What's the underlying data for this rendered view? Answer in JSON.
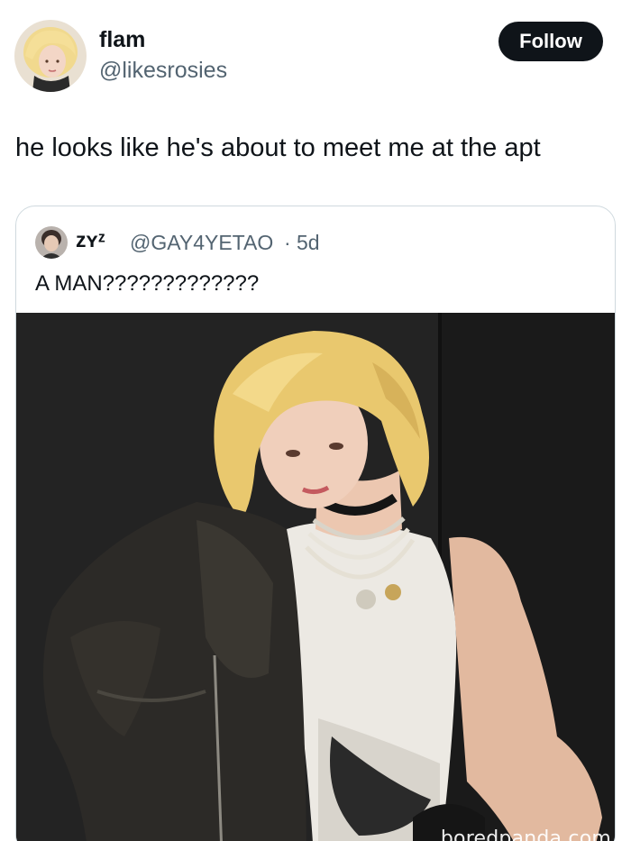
{
  "tweet": {
    "author": {
      "name": "flam",
      "handle": "@likesrosies"
    },
    "follow_label": "Follow",
    "text": "he looks like he's about to meet me at the apt"
  },
  "quoted_tweet": {
    "author": {
      "name": "zʏᶻ",
      "handle": "@GAY4YETAO"
    },
    "separator": "·",
    "time": "5d",
    "text": "A MAN?????????????"
  },
  "watermark": "boredpanda.com",
  "colors": {
    "text_primary": "#0f1419",
    "text_secondary": "#536471",
    "follow_bg": "#0f1419",
    "border": "#cfd9de"
  }
}
